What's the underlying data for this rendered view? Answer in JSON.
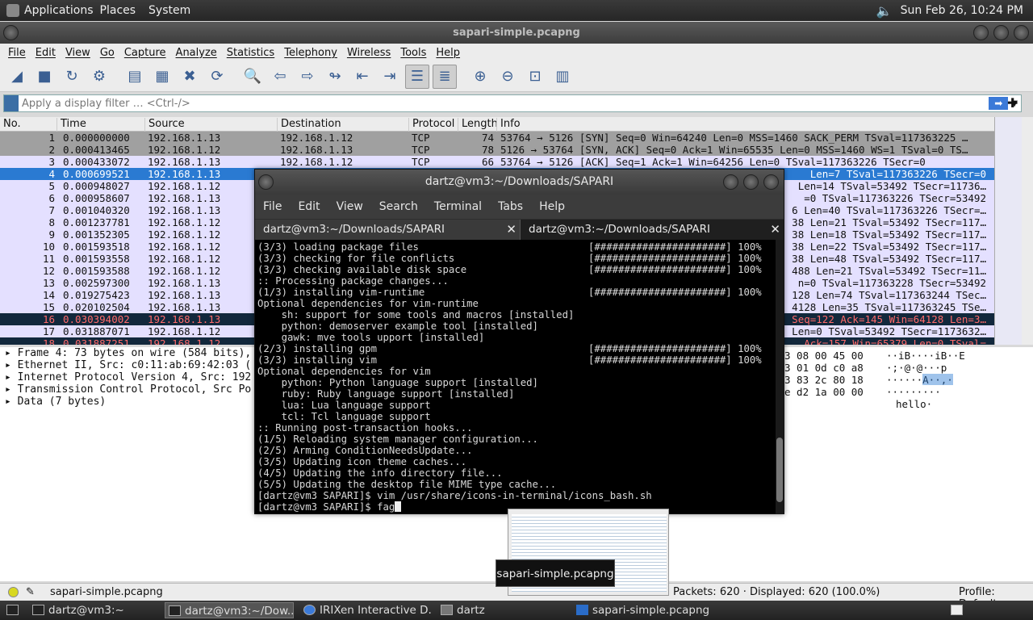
{
  "top_panel": {
    "menus": [
      "Applications",
      "Places",
      "System"
    ],
    "clock": "Sun Feb 26, 10:24 PM"
  },
  "wireshark": {
    "title": "sapari-simple.pcapng",
    "menus": [
      "File",
      "Edit",
      "View",
      "Go",
      "Capture",
      "Analyze",
      "Statistics",
      "Telephony",
      "Wireless",
      "Tools",
      "Help"
    ],
    "filter_placeholder": "Apply a display filter … <Ctrl-/>",
    "columns": [
      "No.",
      "Time",
      "Source",
      "Destination",
      "Protocol",
      "Length",
      "Info"
    ],
    "packets": [
      {
        "no": "1",
        "time": "0.000000000",
        "src": "192.168.1.13",
        "dst": "192.168.1.12",
        "proto": "TCP",
        "len": "74",
        "info": "53764 → 5126 [SYN] Seq=0 Win=64240 Len=0 MSS=1460 SACK_PERM TSval=117363225 …"
      },
      {
        "no": "2",
        "time": "0.000413465",
        "src": "192.168.1.12",
        "dst": "192.168.1.13",
        "proto": "TCP",
        "len": "78",
        "info": "5126 → 53764 [SYN, ACK] Seq=0 Ack=1 Win=65535 Len=0 MSS=1460 WS=1 TSval=0 TS…"
      },
      {
        "no": "3",
        "time": "0.000433072",
        "src": "192.168.1.13",
        "dst": "192.168.1.12",
        "proto": "TCP",
        "len": "66",
        "info": "53764 → 5126 [ACK] Seq=1 Ack=1 Win=64256 Len=0 TSval=117363226 TSecr=0"
      },
      {
        "no": "4",
        "time": "0.000699521",
        "src": "192.168.1.13",
        "dst": "",
        "proto": "",
        "len": "",
        "info": "Len=7 TSval=117363226 TSecr=0"
      },
      {
        "no": "5",
        "time": "0.000948027",
        "src": "192.168.1.12",
        "dst": "",
        "proto": "",
        "len": "",
        "info": "Len=14 TSval=53492 TSecr=11736…"
      },
      {
        "no": "6",
        "time": "0.000958607",
        "src": "192.168.1.13",
        "dst": "",
        "proto": "",
        "len": "",
        "info": "=0 TSval=117363226 TSecr=53492"
      },
      {
        "no": "7",
        "time": "0.001040320",
        "src": "192.168.1.13",
        "dst": "",
        "proto": "",
        "len": "",
        "info": "6 Len=40 TSval=117363226 TSecr=…"
      },
      {
        "no": "8",
        "time": "0.001237781",
        "src": "192.168.1.12",
        "dst": "",
        "proto": "",
        "len": "",
        "info": "38 Len=21 TSval=53492 TSecr=117…"
      },
      {
        "no": "9",
        "time": "0.001352305",
        "src": "192.168.1.12",
        "dst": "",
        "proto": "",
        "len": "",
        "info": "38 Len=18 TSval=53492 TSecr=117…"
      },
      {
        "no": "10",
        "time": "0.001593518",
        "src": "192.168.1.12",
        "dst": "",
        "proto": "",
        "len": "",
        "info": "38 Len=22 TSval=53492 TSecr=117…"
      },
      {
        "no": "11",
        "time": "0.001593558",
        "src": "192.168.1.12",
        "dst": "",
        "proto": "",
        "len": "",
        "info": "38 Len=48 TSval=53492 TSecr=117…"
      },
      {
        "no": "12",
        "time": "0.001593588",
        "src": "192.168.1.12",
        "dst": "",
        "proto": "",
        "len": "",
        "info": "488 Len=21 TSval=53492 TSecr=11…"
      },
      {
        "no": "13",
        "time": "0.002597300",
        "src": "192.168.1.13",
        "dst": "",
        "proto": "",
        "len": "",
        "info": "n=0 TSval=117363228 TSecr=53492"
      },
      {
        "no": "14",
        "time": "0.019275423",
        "src": "192.168.1.13",
        "dst": "",
        "proto": "",
        "len": "",
        "info": "128 Len=74 TSval=117363244 TSec…"
      },
      {
        "no": "15",
        "time": "0.020102504",
        "src": "192.168.1.13",
        "dst": "",
        "proto": "",
        "len": "",
        "info": "4128 Len=35 TSval=117363245 TSe…"
      },
      {
        "no": "16",
        "time": "0.030394002",
        "src": "192.168.1.13",
        "dst": "",
        "proto": "",
        "len": "",
        "info": "Seq=122 Ack=145 Win=64128 Len=3…"
      },
      {
        "no": "17",
        "time": "0.031887071",
        "src": "192.168.1.12",
        "dst": "",
        "proto": "",
        "len": "",
        "info": "Len=0 TSval=53492 TSecr=1173632…"
      },
      {
        "no": "18",
        "time": "0.031887251",
        "src": "192.168.1.12",
        "dst": "",
        "proto": "",
        "len": "",
        "info": "Ack=157 Win=65379 Len=0 TSval="
      }
    ],
    "details": [
      "Frame 4: 73 bytes on wire (584 bits),",
      "Ethernet II, Src: c0:11:ab:69:42:03 (",
      "Internet Protocol Version 4, Src: 192",
      "Transmission Control Protocol, Src Po",
      "Data (7 bytes)"
    ],
    "bytes_hex": [
      "3 08 00 45 00",
      "3 01 0d c0 a8",
      "3 83 2c 80 18",
      "e d2 1a 00 00"
    ],
    "bytes_ascii": [
      "··iB····iB··E",
      "·;·@·@···p",
      "······A··,·",
      "·········"
    ],
    "bytes_ascii_last": "hello·",
    "status": {
      "file": "sapari-simple.pcapng",
      "packets": "Packets: 620 · Displayed: 620 (100.0%)",
      "profile": "Profile: Default"
    }
  },
  "terminal": {
    "title": "dartz@vm3:~/Downloads/SAPARI",
    "menus": [
      "File",
      "Edit",
      "View",
      "Search",
      "Terminal",
      "Tabs",
      "Help"
    ],
    "tabs": [
      "dartz@vm3:~/Downloads/SAPARI",
      "dartz@vm3:~/Downloads/SAPARI"
    ],
    "lines": [
      {
        "l": "(3/3) loading package files",
        "r": "[######################] 100%"
      },
      {
        "l": "(3/3) checking for file conflicts",
        "r": "[######################] 100%"
      },
      {
        "l": "(3/3) checking available disk space",
        "r": "[######################] 100%"
      },
      {
        "l": ":: Processing package changes...",
        "r": ""
      },
      {
        "l": "(1/3) installing vim-runtime",
        "r": "[######################] 100%"
      },
      {
        "l": "Optional dependencies for vim-runtime",
        "r": ""
      },
      {
        "l": "    sh: support for some tools and macros [installed]",
        "r": ""
      },
      {
        "l": "    python: demoserver example tool [installed]",
        "r": ""
      },
      {
        "l": "    gawk: mve tools upport [installed]",
        "r": ""
      },
      {
        "l": "(2/3) installing gpm",
        "r": "[######################] 100%"
      },
      {
        "l": "(3/3) installing vim",
        "r": "[######################] 100%"
      },
      {
        "l": "Optional dependencies for vim",
        "r": ""
      },
      {
        "l": "    python: Python language support [installed]",
        "r": ""
      },
      {
        "l": "    ruby: Ruby language support [installed]",
        "r": ""
      },
      {
        "l": "    lua: Lua language support",
        "r": ""
      },
      {
        "l": "    tcl: Tcl language support",
        "r": ""
      },
      {
        "l": ":: Running post-transaction hooks...",
        "r": ""
      },
      {
        "l": "(1/5) Reloading system manager configuration...",
        "r": ""
      },
      {
        "l": "(2/5) Arming ConditionNeedsUpdate...",
        "r": ""
      },
      {
        "l": "(3/5) Updating icon theme caches...",
        "r": ""
      },
      {
        "l": "(4/5) Updating the info directory file...",
        "r": ""
      },
      {
        "l": "(5/5) Updating the desktop file MIME type cache...",
        "r": ""
      },
      {
        "l": "[dartz@vm3 SAPARI]$ vim /usr/share/icons-in-terminal/icons_bash.sh",
        "r": ""
      }
    ],
    "prompt": "[dartz@vm3 SAPARI]$ fag"
  },
  "tooltip": "sapari-simple.pcapng",
  "taskbar": [
    "dartz@vm3:~",
    "dartz@vm3:~/Dow...",
    "IRIXen Interactive D...",
    "dartz",
    "sapari-simple.pcapng"
  ]
}
